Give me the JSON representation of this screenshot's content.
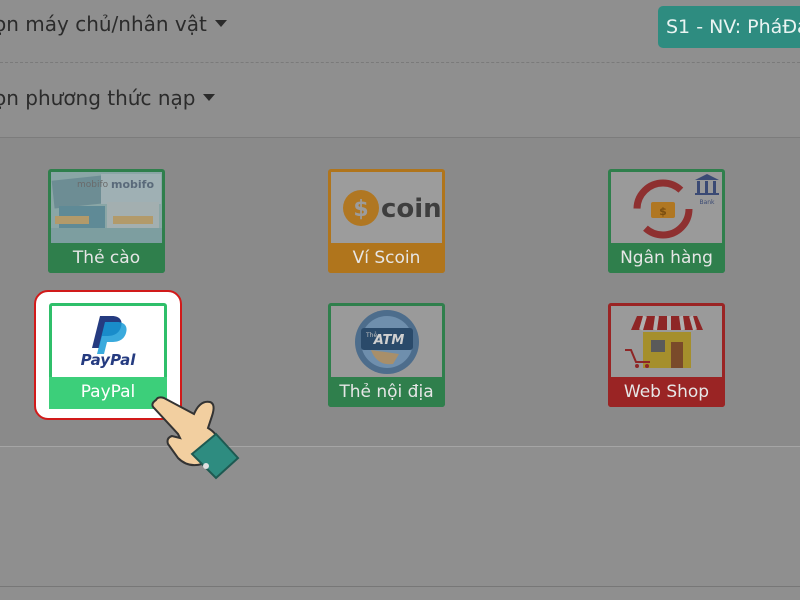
{
  "header": {
    "server_select_label": "ọn máy chủ/nhân vật",
    "server_button": "S1 - NV: PháĐả",
    "method_select_label": "ọn phương thức nạp"
  },
  "methods": {
    "the_cao": "Thẻ cào",
    "vi_scoin": "Ví Scoin",
    "ngan_hang": "Ngân hàng",
    "paypal": "PayPal",
    "the_noi_dia": "Thẻ nội địa",
    "web_shop": "Web Shop"
  },
  "logos": {
    "mobifone": "mobifo",
    "scoin": "coin",
    "scoin_s": "$",
    "bank": "Bank",
    "paypal": "PayPal",
    "atm": "ATM",
    "the": "Thẻ"
  },
  "colors": {
    "green": "#2f7f4c",
    "orange": "#b0751c",
    "red": "#9a2424",
    "teal": "#2e8c80",
    "highlight": "#d11a1a",
    "paypal_navy": "#253b80",
    "paypal_blue": "#179bd7"
  },
  "icons": [
    "caret-down-icon",
    "scoin-logo-icon",
    "bank-transfer-icon",
    "paypal-logo-icon",
    "atm-card-icon",
    "shop-icon",
    "pointing-hand-icon"
  ]
}
